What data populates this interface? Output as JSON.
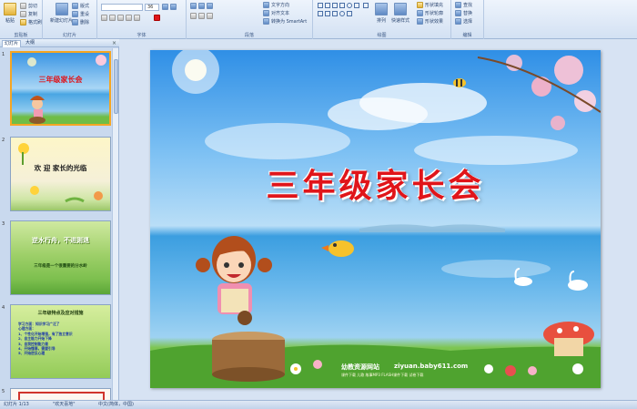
{
  "ribbon": {
    "groups": {
      "clipboard": {
        "label": "剪贴板",
        "paste": "粘贴",
        "cut": "剪切",
        "copy": "复制",
        "format_painter": "格式刷"
      },
      "slides": {
        "label": "幻灯片",
        "new_slide": "新建幻灯片",
        "layout": "版式",
        "reset": "重设",
        "delete": "删除"
      },
      "font": {
        "label": "字体",
        "font_size": "36"
      },
      "paragraph": {
        "label": "段落",
        "text_direction": "文字方向",
        "align_text": "对齐文本",
        "smartart": "转换为 SmartArt"
      },
      "drawing": {
        "label": "绘图",
        "arrange": "排列",
        "quick_styles": "快速样式",
        "shape_fill": "形状填充",
        "shape_outline": "形状轮廓",
        "shape_effects": "形状效果"
      },
      "editing": {
        "label": "编辑",
        "find": "查找",
        "replace": "替换",
        "select": "选择"
      }
    }
  },
  "left_panel": {
    "tab_outline": "幻灯片",
    "tab_slides": "大纲",
    "close": "×",
    "thumbnails": [
      {
        "num": "1",
        "title": "三年级家长会"
      },
      {
        "num": "2",
        "title": "欢 迎 家长的光临"
      },
      {
        "num": "3",
        "title": "逆水行舟，不进则退",
        "subtitle": "三年级是一个很重要的分水岭"
      },
      {
        "num": "4",
        "title": "三年级特点及应对措施",
        "lines": [
          "学习方面：知识学习广泛了",
          "心理方面：",
          "1、个性化开始增强，有了独立意识",
          "2、自主能力开始下降",
          "3、自我控制能力差",
          "4、开始懂事，需要引导",
          "5、开始逆反心理"
        ]
      },
      {
        "num": "5"
      }
    ]
  },
  "slide": {
    "title": "三年级家长会",
    "site_name": "幼教资源网站",
    "site_url": "ziyuan.baby611.com",
    "site_sub": "课件下载 儿歌 故事MP3 FLASH课件下载 试卷下载"
  },
  "statusbar": {
    "slide_count": "幻灯片 1/13",
    "theme": "\"欢天喜地\"",
    "language": "中文(简体，中国)"
  },
  "colors": {
    "title_red": "#e0151a",
    "ribbon_bg": "#d3e1f3",
    "selection_orange": "#f5a623"
  }
}
